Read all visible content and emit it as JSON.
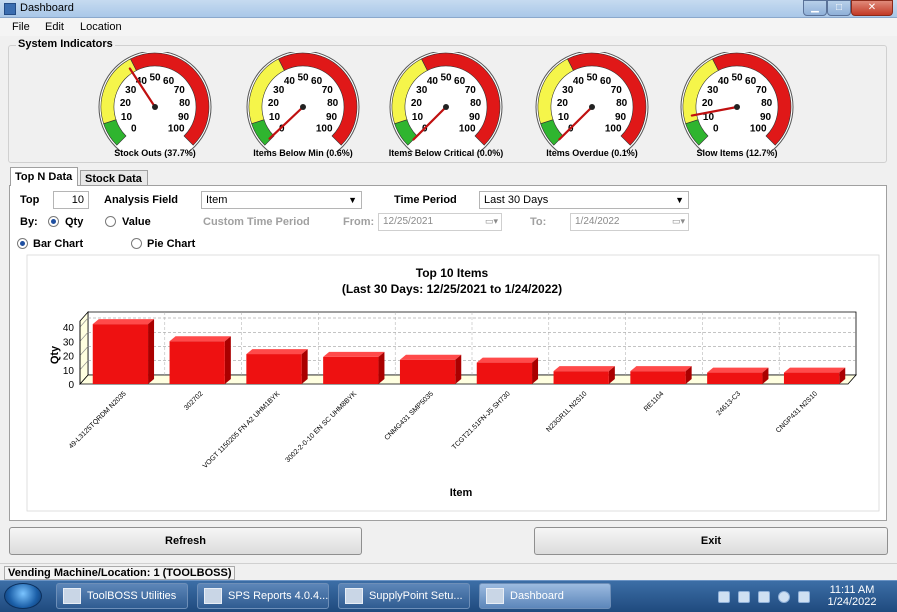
{
  "window": {
    "title": "Dashboard"
  },
  "menu": [
    "File",
    "Edit",
    "Location"
  ],
  "indicators": {
    "title": "System Indicators",
    "gauges": [
      {
        "label": "Stock Outs (37.7%)",
        "value": 37.7
      },
      {
        "label": "Items Below Min (0.6%)",
        "value": 0.6
      },
      {
        "label": "Items Below Critical (0.0%)",
        "value": 0.0
      },
      {
        "label": "Items Overdue (0.1%)",
        "value": 0.1
      },
      {
        "label": "Slow Items (12.7%)",
        "value": 12.7
      }
    ],
    "ticks": [
      "0",
      "10",
      "20",
      "30",
      "40",
      "50",
      "60",
      "70",
      "80",
      "90",
      "100"
    ],
    "colors": {
      "green": "#2fb52f",
      "yellow": "#f5f54a",
      "red": "#e01818"
    }
  },
  "tabs": [
    "Top N Data",
    "Stock Data"
  ],
  "controls": {
    "top_label": "Top",
    "top_value": "10",
    "analysis_label": "Analysis Field",
    "analysis_value": "Item",
    "period_label": "Time Period",
    "period_value": "Last 30 Days",
    "by_label": "By:",
    "qty_label": "Qty",
    "value_label": "Value",
    "custom_label": "Custom Time Period",
    "from_label": "From:",
    "from_value": "12/25/2021",
    "to_label": "To:",
    "to_value": "1/24/2022",
    "bar_label": "Bar Chart",
    "pie_label": "Pie Chart"
  },
  "chart_data": {
    "type": "bar",
    "title": "Top 10 Items",
    "subtitle": "(Last 30 Days: 12/25/2021 to 1/24/2022)",
    "xlabel": "Item",
    "ylabel": "Qty",
    "ylim": [
      0,
      40
    ],
    "yticks": [
      "0",
      "10",
      "20",
      "30",
      "40"
    ],
    "categories": [
      "49-L3125TQRDM N2035",
      "302702",
      "VOGT 1150205 FN A2 UHM1BYK",
      "3002-2-0-10 EN SC UHM8BYK",
      "CNMG431 SMP5035",
      "TCGT21.51FN-J5 SH730",
      "N23GR1L N2S10",
      "RE1104",
      "24613-C3",
      "CNGP431 N2S10"
    ],
    "values": [
      42,
      30,
      21,
      19,
      17,
      15,
      9,
      9,
      8,
      8
    ],
    "colors": {
      "bar": "#ee1111",
      "bar_top": "#ff4a4a",
      "bar_side": "#aa0000"
    },
    "grid": true
  },
  "buttons": {
    "refresh": "Refresh",
    "exit": "Exit"
  },
  "status": {
    "text": "Vending Machine/Location: 1 (TOOLBOSS)"
  },
  "taskbar": {
    "items": [
      "ToolBOSS Utilities",
      "SPS Reports 4.0.4....",
      "SupplyPoint Setu...",
      "Dashboard"
    ],
    "time": "11:11 AM",
    "date": "1/24/2022"
  }
}
